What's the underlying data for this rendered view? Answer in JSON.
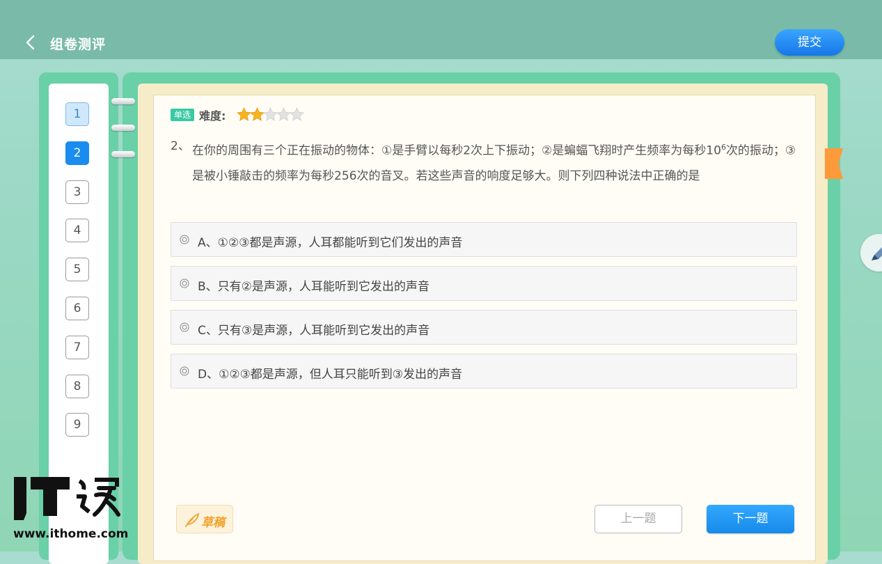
{
  "header": {
    "title": "组卷测评",
    "submit_label": "提交"
  },
  "sidebar": {
    "question_numbers": [
      "1",
      "2",
      "3",
      "4",
      "5",
      "6",
      "7",
      "8",
      "9"
    ],
    "done": [
      "1"
    ],
    "current": "2"
  },
  "question": {
    "type_badge": "单选",
    "difficulty_label": "难度:",
    "difficulty_rating": 2,
    "difficulty_max": 5,
    "number": "2、",
    "text_part1": "在你的周围有三个正在振动的物体：①是手臂以每秒2次上下振动；②是蝙蝠飞翔时产生频率为每秒10",
    "superscript": "6",
    "text_part2": "次的振动；③是被小锤敲击的频率为每秒256次的音叉。若这些声音的响度足够大。则下列四种说法中正确的是",
    "options": [
      {
        "label": "A、①②③都是声源，人耳都能听到它们发出的声音"
      },
      {
        "label": "B、只有②是声源，人耳能听到它发出的声音"
      },
      {
        "label": "C、只有③是声源，人耳能听到它发出的声音"
      },
      {
        "label": "D、①②③都是声源，但人耳只能听到③发出的声音"
      }
    ]
  },
  "footer": {
    "draft_label": "草稿",
    "prev_label": "上一题",
    "next_label": "下一题"
  },
  "watermark": {
    "logo_text": "IT之家",
    "url": "www.ithome.com"
  },
  "colors": {
    "topbar": "#79bba8",
    "frame": "#6ad0a8",
    "accent_blue": "#1a8cf0",
    "star_gold": "#f7b41e",
    "bookmark": "#ff9a3a"
  }
}
